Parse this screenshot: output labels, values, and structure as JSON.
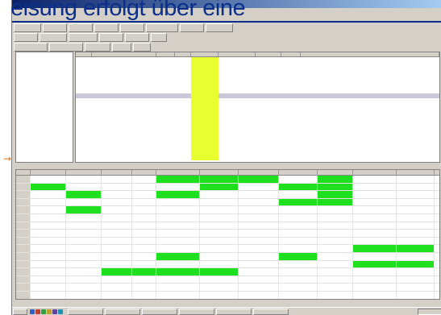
{
  "heading": "eisung erfolgt über eine",
  "toolbar_rows": [
    [
      {
        "label": "",
        "w": 34
      },
      {
        "label": "",
        "w": 30
      },
      {
        "label": "",
        "w": 30
      },
      {
        "label": "",
        "w": 30
      },
      {
        "label": "",
        "w": 30
      },
      {
        "label": "",
        "w": 40
      },
      {
        "label": "",
        "w": 30
      },
      {
        "label": "",
        "w": 34
      }
    ],
    [
      {
        "label": "",
        "w": 30
      },
      {
        "label": "",
        "w": 34
      },
      {
        "label": "",
        "w": 36
      },
      {
        "label": "",
        "w": 30
      },
      {
        "label": "",
        "w": 30
      },
      {
        "label": "",
        "w": 20
      }
    ],
    [
      {
        "label": "",
        "w": 42
      },
      {
        "label": "",
        "w": 42
      },
      {
        "label": "",
        "w": 32
      },
      {
        "label": "",
        "w": 24
      },
      {
        "label": "",
        "w": 22
      }
    ]
  ],
  "tree_items": [
    "",
    "",
    "",
    "",
    "",
    "",
    "",
    "",
    "",
    "",
    "",
    "",
    "",
    "",
    "",
    "",
    ""
  ],
  "list": {
    "columns": [
      {
        "label": "",
        "w": 20
      },
      {
        "label": "",
        "w": 80
      },
      {
        "label": "",
        "w": 24
      },
      {
        "label": "",
        "w": 20
      },
      {
        "label": "",
        "w": 34
      },
      {
        "label": "",
        "w": 46
      },
      {
        "label": "",
        "w": 32
      },
      {
        "label": "",
        "w": 24
      },
      {
        "label": "",
        "w": 173
      }
    ],
    "rows": 20,
    "selected_row": 7
  },
  "grid": {
    "col_widths": [
      18,
      44,
      44,
      38,
      30,
      54,
      48,
      50,
      48,
      44,
      54,
      47
    ],
    "rows": [
      [
        {
          "t": "",
          "c": "rh"
        },
        {
          "t": ""
        },
        {
          "t": ""
        },
        {
          "t": ""
        },
        {
          "t": ""
        },
        {
          "t": "",
          "c": "hl"
        },
        {
          "t": "",
          "c": "hl"
        },
        {
          "t": "",
          "c": "hl"
        },
        {
          "t": ""
        },
        {
          "t": "",
          "c": "hl"
        },
        {
          "t": ""
        },
        {
          "t": ""
        }
      ],
      [
        {
          "t": "",
          "c": "rh"
        },
        {
          "t": "",
          "c": "hl"
        },
        {
          "t": ""
        },
        {
          "t": ""
        },
        {
          "t": ""
        },
        {
          "t": ""
        },
        {
          "t": "",
          "c": "hl"
        },
        {
          "t": ""
        },
        {
          "t": "",
          "c": "hl"
        },
        {
          "t": "",
          "c": "hl"
        },
        {
          "t": ""
        },
        {
          "t": ""
        }
      ],
      [
        {
          "t": "",
          "c": "rh"
        },
        {
          "t": ""
        },
        {
          "t": "",
          "c": "hl"
        },
        {
          "t": ""
        },
        {
          "t": ""
        },
        {
          "t": "",
          "c": "hl"
        },
        {
          "t": ""
        },
        {
          "t": ""
        },
        {
          "t": ""
        },
        {
          "t": "",
          "c": "hl"
        },
        {
          "t": ""
        },
        {
          "t": ""
        }
      ],
      [
        {
          "t": "",
          "c": "rh"
        },
        {
          "t": ""
        },
        {
          "t": ""
        },
        {
          "t": ""
        },
        {
          "t": ""
        },
        {
          "t": ""
        },
        {
          "t": ""
        },
        {
          "t": ""
        },
        {
          "t": "",
          "c": "hl"
        },
        {
          "t": "",
          "c": "hl"
        },
        {
          "t": ""
        },
        {
          "t": ""
        }
      ],
      [
        {
          "t": "",
          "c": "rh"
        },
        {
          "t": ""
        },
        {
          "t": "",
          "c": "hl"
        },
        {
          "t": ""
        },
        {
          "t": ""
        },
        {
          "t": ""
        },
        {
          "t": ""
        },
        {
          "t": ""
        },
        {
          "t": ""
        },
        {
          "t": ""
        },
        {
          "t": ""
        },
        {
          "t": ""
        }
      ],
      [
        {
          "t": "",
          "c": "rh"
        },
        {
          "t": ""
        },
        {
          "t": ""
        },
        {
          "t": ""
        },
        {
          "t": ""
        },
        {
          "t": ""
        },
        {
          "t": ""
        },
        {
          "t": ""
        },
        {
          "t": ""
        },
        {
          "t": ""
        },
        {
          "t": ""
        },
        {
          "t": ""
        }
      ],
      [
        {
          "t": "",
          "c": "rh"
        },
        {
          "t": ""
        },
        {
          "t": ""
        },
        {
          "t": ""
        },
        {
          "t": ""
        },
        {
          "t": ""
        },
        {
          "t": ""
        },
        {
          "t": ""
        },
        {
          "t": ""
        },
        {
          "t": ""
        },
        {
          "t": ""
        },
        {
          "t": ""
        }
      ],
      [
        {
          "t": "",
          "c": "rh"
        },
        {
          "t": ""
        },
        {
          "t": ""
        },
        {
          "t": ""
        },
        {
          "t": ""
        },
        {
          "t": ""
        },
        {
          "t": ""
        },
        {
          "t": ""
        },
        {
          "t": ""
        },
        {
          "t": ""
        },
        {
          "t": ""
        },
        {
          "t": ""
        }
      ],
      [
        {
          "t": "",
          "c": "rh"
        },
        {
          "t": ""
        },
        {
          "t": ""
        },
        {
          "t": ""
        },
        {
          "t": ""
        },
        {
          "t": ""
        },
        {
          "t": ""
        },
        {
          "t": ""
        },
        {
          "t": ""
        },
        {
          "t": ""
        },
        {
          "t": ""
        },
        {
          "t": ""
        }
      ],
      [
        {
          "t": "",
          "c": "rh"
        },
        {
          "t": ""
        },
        {
          "t": ""
        },
        {
          "t": ""
        },
        {
          "t": ""
        },
        {
          "t": ""
        },
        {
          "t": ""
        },
        {
          "t": ""
        },
        {
          "t": ""
        },
        {
          "t": ""
        },
        {
          "t": "",
          "c": "hl"
        },
        {
          "t": "",
          "c": "hl"
        }
      ],
      [
        {
          "t": "",
          "c": "rh"
        },
        {
          "t": ""
        },
        {
          "t": ""
        },
        {
          "t": ""
        },
        {
          "t": ""
        },
        {
          "t": "",
          "c": "hl"
        },
        {
          "t": ""
        },
        {
          "t": ""
        },
        {
          "t": "",
          "c": "hl"
        },
        {
          "t": ""
        },
        {
          "t": ""
        },
        {
          "t": ""
        }
      ],
      [
        {
          "t": "",
          "c": "rh"
        },
        {
          "t": ""
        },
        {
          "t": ""
        },
        {
          "t": ""
        },
        {
          "t": ""
        },
        {
          "t": ""
        },
        {
          "t": ""
        },
        {
          "t": ""
        },
        {
          "t": ""
        },
        {
          "t": ""
        },
        {
          "t": "",
          "c": "hl"
        },
        {
          "t": "",
          "c": "hl"
        }
      ],
      [
        {
          "t": "",
          "c": "rh"
        },
        {
          "t": ""
        },
        {
          "t": ""
        },
        {
          "t": "",
          "c": "hl"
        },
        {
          "t": "",
          "c": "hl"
        },
        {
          "t": "",
          "c": "hl"
        },
        {
          "t": "",
          "c": "hl"
        },
        {
          "t": ""
        },
        {
          "t": ""
        },
        {
          "t": ""
        },
        {
          "t": ""
        },
        {
          "t": ""
        }
      ],
      [
        {
          "t": "",
          "c": "rh"
        },
        {
          "t": ""
        },
        {
          "t": ""
        },
        {
          "t": ""
        },
        {
          "t": ""
        },
        {
          "t": ""
        },
        {
          "t": ""
        },
        {
          "t": ""
        },
        {
          "t": ""
        },
        {
          "t": ""
        },
        {
          "t": ""
        },
        {
          "t": ""
        }
      ],
      [
        {
          "t": "",
          "c": "rh"
        },
        {
          "t": ""
        },
        {
          "t": ""
        },
        {
          "t": ""
        },
        {
          "t": ""
        },
        {
          "t": ""
        },
        {
          "t": ""
        },
        {
          "t": ""
        },
        {
          "t": ""
        },
        {
          "t": ""
        },
        {
          "t": ""
        },
        {
          "t": ""
        }
      ],
      [
        {
          "t": "",
          "c": "rh"
        },
        {
          "t": ""
        },
        {
          "t": ""
        },
        {
          "t": ""
        },
        {
          "t": ""
        },
        {
          "t": ""
        },
        {
          "t": ""
        },
        {
          "t": ""
        },
        {
          "t": ""
        },
        {
          "t": ""
        },
        {
          "t": ""
        },
        {
          "t": ""
        }
      ]
    ]
  },
  "taskbar": {
    "start": "",
    "tasks": [
      "",
      "",
      "",
      "",
      "",
      ""
    ],
    "clock": ""
  },
  "colors": {
    "highlight": "#1ee01e",
    "heading": "#0b2f8a",
    "arrow": "#e07020"
  },
  "icons": {
    "left_arrow": "arrow-right-icon"
  }
}
